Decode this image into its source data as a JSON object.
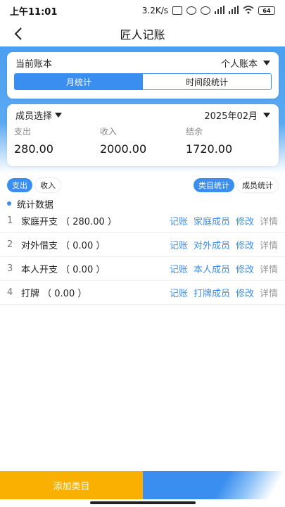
{
  "status_bar": {
    "time": "上午11:01",
    "network_speed": "3.2K/s",
    "battery": "64"
  },
  "nav": {
    "title": "匠人记账"
  },
  "account_card": {
    "label": "当前账本",
    "selected": "个人账本",
    "tabs": [
      "月统计",
      "时间段统计"
    ],
    "active_tab": "月统计"
  },
  "summary_card": {
    "member_select": "成员选择",
    "month": "2025年02月",
    "stats": [
      {
        "label": "支出",
        "value": "280.00"
      },
      {
        "label": "收入",
        "value": "2000.00"
      },
      {
        "label": "结余",
        "value": "1720.00"
      }
    ]
  },
  "filter_tabs": {
    "left": [
      {
        "label": "支出",
        "active": true
      },
      {
        "label": "收入",
        "active": false
      }
    ],
    "right": [
      {
        "label": "类目统计",
        "active": true
      },
      {
        "label": "成员统计",
        "active": false
      }
    ]
  },
  "section": {
    "title": "统计数据"
  },
  "items": [
    {
      "idx": "1",
      "name": "家庭开支 （ 280.00 ）",
      "actions": [
        "记账",
        "家庭成员",
        "修改",
        "详情"
      ]
    },
    {
      "idx": "2",
      "name": "对外借支 （ 0.00 ）",
      "actions": [
        "记账",
        "对外成员",
        "修改",
        "详情"
      ]
    },
    {
      "idx": "3",
      "name": "本人开支 （ 0.00 ）",
      "actions": [
        "记账",
        "本人成员",
        "修改",
        "详情"
      ]
    },
    {
      "idx": "4",
      "name": "打牌 （ 0.00 ）",
      "actions": [
        "记账",
        "打牌成员",
        "修改",
        "详情"
      ]
    }
  ],
  "footer": {
    "add_label": "添加类目"
  },
  "colors": {
    "accent": "#3a8ef0",
    "header_band": "#4b9ff0",
    "add_button": "#f9b000"
  }
}
